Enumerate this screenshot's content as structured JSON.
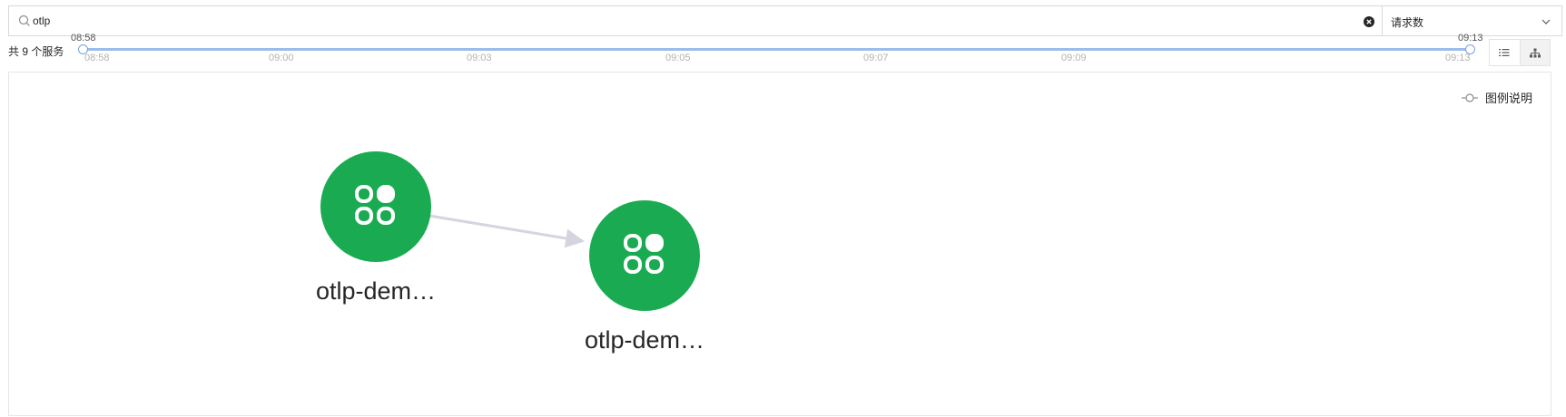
{
  "search": {
    "value": "otlp",
    "placeholder": ""
  },
  "metric_select": {
    "value": "请求数"
  },
  "service_count": "共 9 个服务",
  "timeline": {
    "start_label": "08:58",
    "end_label": "09:13",
    "ticks": [
      "08:58",
      "09:00",
      "09:03",
      "09:05",
      "09:07",
      "09:09",
      "09:13"
    ]
  },
  "legend": {
    "label": "图例说明"
  },
  "graph": {
    "nodes": [
      {
        "id": "n1",
        "label": "otlp-dem…",
        "icon": "service-app-icon"
      },
      {
        "id": "n2",
        "label": "otlp-dem…",
        "icon": "service-app-icon"
      }
    ],
    "edges": [
      {
        "from": "n1",
        "to": "n2"
      }
    ]
  },
  "colors": {
    "node_fill": "#1aab52",
    "edge": "#d5d5e0",
    "track": "#9dbcec",
    "border": "#d9d9d9"
  },
  "icons": {
    "search": "search-icon",
    "clear": "clear-icon",
    "dropdown": "chevron-down-icon",
    "list_view": "list-view-icon",
    "topology_view": "topology-view-icon",
    "legend": "legend-icon"
  }
}
